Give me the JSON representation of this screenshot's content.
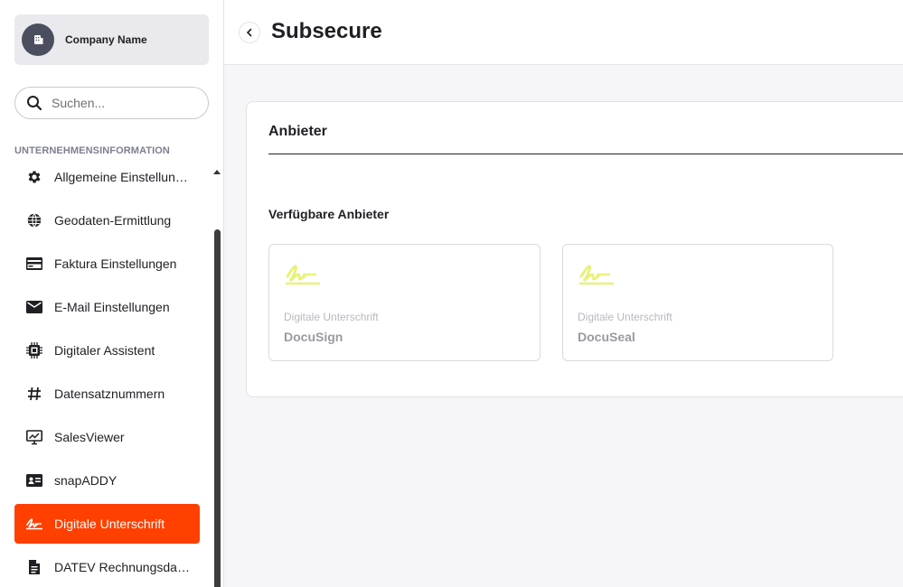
{
  "company": {
    "name": "Company Name"
  },
  "search": {
    "placeholder": "Suchen..."
  },
  "sidebar": {
    "section_label": "UNTERNEHMENSINFORMATION",
    "items": [
      {
        "label": "Allgemeine Einstellungen",
        "icon": "gear-icon"
      },
      {
        "label": "Geodaten-Ermittlung",
        "icon": "globe-icon"
      },
      {
        "label": "Faktura Einstellungen",
        "icon": "credit-card-icon"
      },
      {
        "label": "E-Mail Einstellungen",
        "icon": "mail-icon"
      },
      {
        "label": "Digitaler Assistent",
        "icon": "chip-icon"
      },
      {
        "label": "Datensatznummern",
        "icon": "hash-icon"
      },
      {
        "label": "SalesViewer",
        "icon": "monitor-chart-icon"
      },
      {
        "label": "snapADDY",
        "icon": "id-card-icon"
      },
      {
        "label": "Digitale Unterschrift",
        "icon": "signature-icon",
        "active": true
      },
      {
        "label": "DATEV Rechnungsdaten",
        "icon": "document-icon"
      }
    ]
  },
  "header": {
    "title": "Subsecure"
  },
  "main": {
    "card_title": "Anbieter",
    "providers_title": "Verfügbare Anbieter",
    "providers": [
      {
        "category": "Digitale Unterschrift",
        "name": "DocuSign"
      },
      {
        "category": "Digitale Unterschrift",
        "name": "DocuSeal"
      }
    ]
  },
  "colors": {
    "accent": "#ff4000",
    "logo_yellow": "#e8f27a",
    "avatar": "#4b4e5e"
  }
}
